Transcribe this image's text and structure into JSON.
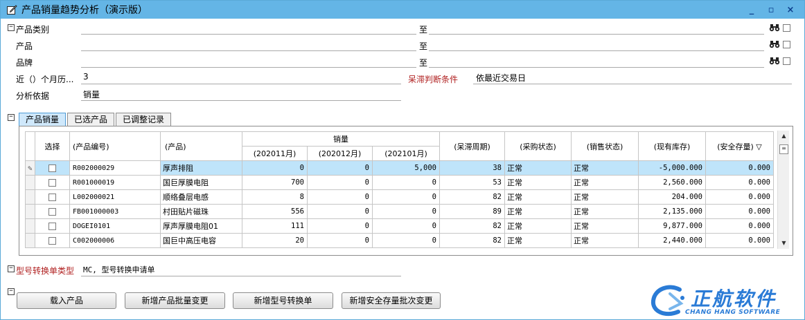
{
  "window": {
    "title": "产品销量趋势分析（演示版）",
    "controls": [
      "_",
      "▫",
      "×"
    ]
  },
  "filters": {
    "category": {
      "label": "产品类别",
      "to": "至"
    },
    "product": {
      "label": "产品",
      "to": "至"
    },
    "brand": {
      "label": "品牌",
      "to": "至"
    },
    "months": {
      "label": "近（）个月历...",
      "value": "3"
    },
    "stagnant": {
      "label": "呆滞判断条件",
      "value": "依最近交易日"
    },
    "basis": {
      "label": "分析依据",
      "value": "销量"
    }
  },
  "tabs": [
    {
      "label": "产品销量",
      "active": true
    },
    {
      "label": "已选产品",
      "active": false
    },
    {
      "label": "已调整记录",
      "active": false
    }
  ],
  "grid": {
    "headers": {
      "select": "选择",
      "code": "(产品编号)",
      "name": "(产品)",
      "sales": "销量",
      "m1": "(202011月)",
      "m2": "(202012月)",
      "m3": "(202101月)",
      "cycle": "(呆滞周期)",
      "purchase": "(采购状态)",
      "sale_status": "(销售状态)",
      "stock": "(现有库存)",
      "safety": "(安全存量) ▽"
    },
    "rows": [
      {
        "code": "R002000029",
        "name": "厚声排阻",
        "m1": "0",
        "m2": "0",
        "m3": "5,000",
        "cycle": "38",
        "purchase": "正常",
        "sale": "正常",
        "stock": "-5,000.000",
        "safety": "0.000",
        "selected": true
      },
      {
        "code": "R001000019",
        "name": "国巨厚膜电阻",
        "m1": "700",
        "m2": "0",
        "m3": "0",
        "cycle": "53",
        "purchase": "正常",
        "sale": "正常",
        "stock": "2,560.000",
        "safety": "0.000",
        "selected": false
      },
      {
        "code": "L002000021",
        "name": "顺络叠层电感",
        "m1": "8",
        "m2": "0",
        "m3": "0",
        "cycle": "82",
        "purchase": "正常",
        "sale": "正常",
        "stock": "204.000",
        "safety": "0.000",
        "selected": false
      },
      {
        "code": "FB001000003",
        "name": "村田贴片磁珠",
        "m1": "556",
        "m2": "0",
        "m3": "0",
        "cycle": "89",
        "purchase": "正常",
        "sale": "正常",
        "stock": "2,135.000",
        "safety": "0.000",
        "selected": false
      },
      {
        "code": "DOGEI0101",
        "name": "厚声厚膜电阻01",
        "m1": "111",
        "m2": "0",
        "m3": "0",
        "cycle": "82",
        "purchase": "正常",
        "sale": "正常",
        "stock": "9,877.000",
        "safety": "0.000",
        "selected": false
      },
      {
        "code": "C002000006",
        "name": "国巨中高压电容",
        "m1": "20",
        "m2": "0",
        "m3": "0",
        "cycle": "82",
        "purchase": "正常",
        "sale": "正常",
        "stock": "2,440.000",
        "safety": "0.000",
        "selected": false
      }
    ]
  },
  "conversion": {
    "label": "型号转换单类型",
    "value": "MC, 型号转换申请单"
  },
  "buttons": {
    "load": "载入产品",
    "batch": "新增产品批量变更",
    "convert": "新增型号转换单",
    "safety": "新增安全存量批次变更"
  },
  "logo": {
    "brand": "正航软件",
    "sub": "CHANG HANG SOFTWARE"
  },
  "colors": {
    "titlebar": "#64b5e6",
    "accent_red": "#b02020",
    "logo_blue": "#2a7bd6",
    "selected_row": "#bfe4fa"
  }
}
